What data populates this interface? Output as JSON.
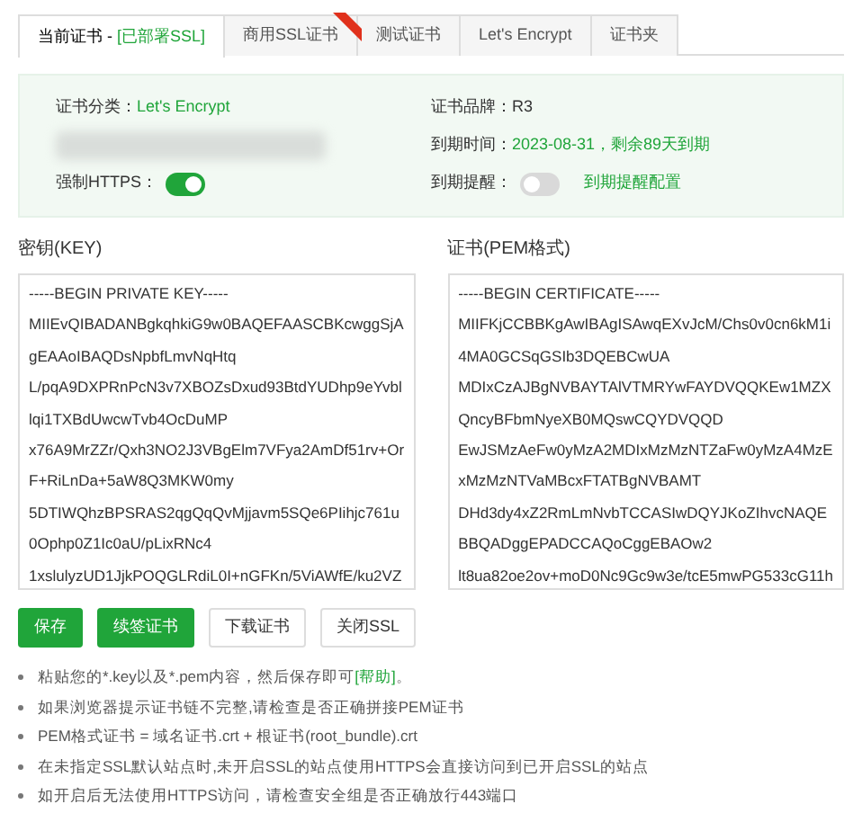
{
  "tabs": [
    {
      "label": "当前证书 - ",
      "status": "[已部署SSL]",
      "selected": true,
      "ribbon": false
    },
    {
      "label": "商用SSL证书",
      "selected": false,
      "ribbon": true
    },
    {
      "label": "测试证书",
      "selected": false,
      "ribbon": false
    },
    {
      "label": "Let's Encrypt",
      "selected": false,
      "ribbon": false
    },
    {
      "label": "证书夹",
      "selected": false,
      "ribbon": false
    }
  ],
  "info": {
    "category_label": "证书分类：",
    "category": "Let's Encrypt",
    "brand_label": "证书品牌：",
    "brand": "R3",
    "expiry_label": "到期时间：",
    "expiry": "2023-08-31，剩余89天到期",
    "force_https_label": "强制HTTPS：",
    "force_https_on": true,
    "reminder_label": "到期提醒：",
    "reminder_on": false,
    "reminder_link": "到期提醒配置"
  },
  "key": {
    "label": "密钥(KEY)",
    "lines": [
      "-----BEGIN PRIVATE KEY-----",
      "MIIEvQIBADANBgkqhkiG9w0BAQEFAASCBKcwggSjA",
      "gEAAoIBAQDsNpbfLmvNqHtq",
      "L/pqA9DXPRnPcN3v7XBOZsDxud93BtdYUDhp9eYvbl",
      "lqi1TXBdUwcwTvb4OcDuMP",
      "x76A9MrZZr/Qxh3NO2J3VBgElm7VFya2AmDf51rv+Or",
      "F+RiLnDa+5aW8Q3MKW0my",
      "5DTIWQhzBPSRAS2qgQqQvMjjavm5SQe6PIihjc761u",
      "0Ophp0Z1Ic0aU/pLixRNc4",
      "1xslulyzUD1JjkPOQGLRdiL0I+nGFKn/5ViAWfE/ku2VZ"
    ]
  },
  "cert": {
    "label": "证书(PEM格式)",
    "lines": [
      "-----BEGIN CERTIFICATE-----",
      "MIIFKjCCBBKgAwIBAgISAwqEXvJcM/Chs0v0cn6kM1i",
      "4MA0GCSqGSIb3DQEBCwUA",
      "MDIxCzAJBgNVBAYTAlVTMRYwFAYDVQQKEw1MZX",
      "QncyBFbmNyeXB0MQswCQYDVQQD",
      "EwJSMzAeFw0yMzA2MDIxMzMzNTZaFw0yMzA4MzE",
      "xMzMzNTVaMBcxFTATBgNVBAMT",
      "DHd3dy4xZ2RmLmNvbTCCASIwDQYJKoZIhvcNAQE",
      "BBQADggEPADCCAQoCggEBAOw2",
      "lt8ua82oe2ov+moD0Nc9Gc9w3e/tcE5mwPG533cG11h"
    ]
  },
  "buttons": [
    {
      "label": "保存",
      "kind": "primary"
    },
    {
      "label": "续签证书",
      "kind": "primary"
    },
    {
      "label": "下载证书",
      "kind": "default"
    },
    {
      "label": "关闭SSL",
      "kind": "default"
    }
  ],
  "notes": [
    "粘贴您的*.key以及*.pem内容，然后保存即可**[帮助]**。",
    "如果浏览器提示证书链不完整,请检查是否正确拼接PEM证书",
    "PEM格式证书 = 域名证书.crt + 根证书(root_bundle).crt",
    "在未指定SSL默认站点时,未开启SSL的站点使用HTTPS会直接访问到已开启SSL的站点",
    "如开启后无法使用HTTPS访问，请检查安全组是否正确放行443端口"
  ]
}
